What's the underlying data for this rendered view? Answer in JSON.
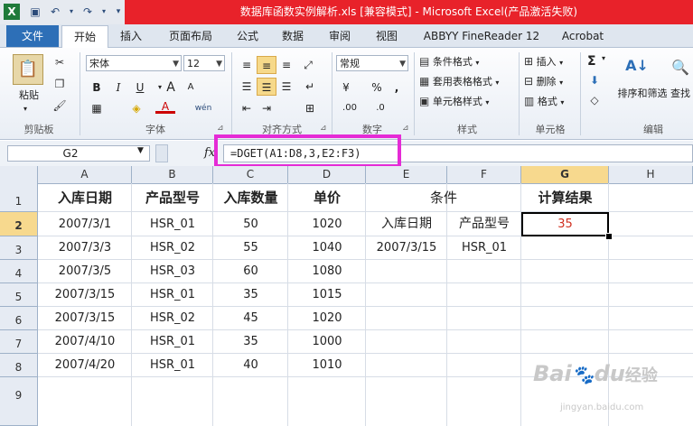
{
  "window": {
    "title": "数据库函数实例解析.xls  [兼容模式]  -  Microsoft Excel(产品激活失败)",
    "app_icon": "excel-icon"
  },
  "tabs": {
    "file": "文件",
    "items": [
      "开始",
      "插入",
      "页面布局",
      "公式",
      "数据",
      "审阅",
      "视图",
      "ABBYY FineReader 12",
      "Acrobat"
    ],
    "active": "开始"
  },
  "ribbon": {
    "clipboard": {
      "paste": "粘贴",
      "label": "剪贴板"
    },
    "font": {
      "name": "宋体",
      "size": "12",
      "bold": "B",
      "italic": "I",
      "underline": "U",
      "font_color": "A",
      "grow": "A",
      "shrink": "A",
      "label": "字体",
      "wen": "wén"
    },
    "alignment": {
      "label": "对齐方式"
    },
    "number": {
      "format": "常规",
      "percent": "%",
      "comma": ",",
      "label": "数字",
      "inc_dec": ".00",
      "dec_dec": ".0"
    },
    "styles": {
      "conditional": "条件格式",
      "table": "套用表格格式",
      "cell": "单元格样式",
      "label": "样式"
    },
    "cells": {
      "insert": "插入",
      "delete": "删除",
      "format": "格式",
      "label": "单元格"
    },
    "editing": {
      "sort": "排序和筛选",
      "find": "查找",
      "label": "编辑",
      "sum": "Σ"
    }
  },
  "formula_bar": {
    "name_box": "G2",
    "fx": "fx",
    "formula": "=DGET(A1:D8,3,E2:F3)"
  },
  "columns": [
    "A",
    "B",
    "C",
    "D",
    "E",
    "F",
    "G",
    "H"
  ],
  "rows": [
    "1",
    "2",
    "3",
    "4",
    "5",
    "6",
    "7",
    "8",
    "9"
  ],
  "cells": {
    "headers": [
      "入库日期",
      "产品型号",
      "入库数量",
      "单价"
    ],
    "condition_title": "条件",
    "result_title": "计算结果",
    "data": [
      [
        "2007/3/1",
        "HSR_01",
        "50",
        "1020"
      ],
      [
        "2007/3/3",
        "HSR_02",
        "55",
        "1040"
      ],
      [
        "2007/3/5",
        "HSR_03",
        "60",
        "1080"
      ],
      [
        "2007/3/15",
        "HSR_01",
        "35",
        "1015"
      ],
      [
        "2007/3/15",
        "HSR_02",
        "45",
        "1020"
      ],
      [
        "2007/4/10",
        "HSR_01",
        "35",
        "1000"
      ],
      [
        "2007/4/20",
        "HSR_01",
        "40",
        "1010"
      ]
    ],
    "criteria": {
      "e2": "入库日期",
      "f2": "产品型号",
      "e3": "2007/3/15",
      "f3": "HSR_01"
    },
    "result": "35"
  },
  "watermark": {
    "brand": "Bai",
    "du": "du",
    "jingyan": "经验",
    "url": "jingyan.baidu.com"
  },
  "colors": {
    "title_bar": "#e8222a",
    "file_tab": "#2d6fb7",
    "highlight": "#e52bd6",
    "result_text": "#d03020"
  }
}
